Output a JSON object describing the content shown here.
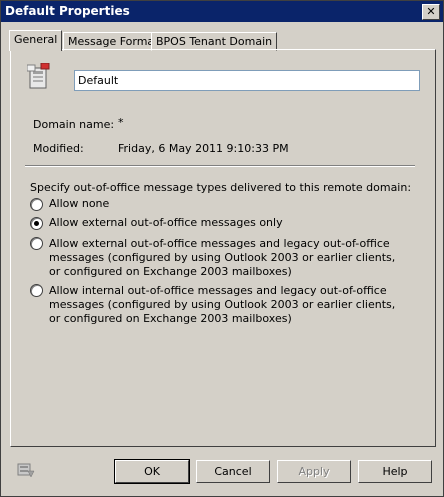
{
  "window": {
    "title": "Default Properties"
  },
  "tabs": [
    {
      "label": "General",
      "active": true
    },
    {
      "label": "Message Format",
      "active": false
    },
    {
      "label": "BPOS Tenant Domain",
      "active": false
    }
  ],
  "general": {
    "name_value": "Default",
    "domain_label": "Domain name:",
    "domain_value": "*",
    "modified_label": "Modified:",
    "modified_value": "Friday, 6 May 2011 9:10:33 PM",
    "ooo_heading": "Specify out-of-office message types delivered to this remote domain:",
    "options": [
      {
        "label": "Allow none",
        "checked": false
      },
      {
        "label": "Allow external out-of-office messages only",
        "checked": true
      },
      {
        "label": "Allow external out-of-office messages and legacy out-of-office messages (configured by using Outlook 2003 or earlier clients, or configured on Exchange 2003 mailboxes)",
        "checked": false
      },
      {
        "label": "Allow internal out-of-office messages and legacy out-of-office messages (configured by using Outlook 2003 or earlier clients, or configured on Exchange 2003 mailboxes)",
        "checked": false
      }
    ]
  },
  "buttons": {
    "ok": "OK",
    "cancel": "Cancel",
    "apply": "Apply",
    "help": "Help"
  },
  "icons": {
    "app": "remote-domain-icon",
    "footer": "help-context-icon",
    "close": "close-icon"
  }
}
